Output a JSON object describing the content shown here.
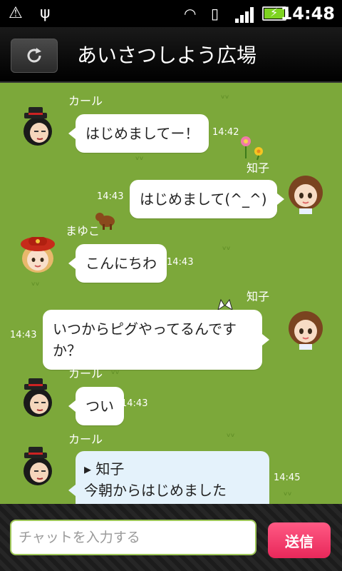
{
  "status_bar": {
    "time": "14:48",
    "icons": [
      "warning-icon",
      "usb-icon",
      "wifi-icon",
      "rotate-icon",
      "signal-icon",
      "battery-charging-icon"
    ]
  },
  "header": {
    "title": "あいさつしよう広場",
    "refresh_icon": "refresh-icon"
  },
  "messages": [
    {
      "sender": "カール",
      "text": "はじめましてー！",
      "time": "14:42",
      "side": "left"
    },
    {
      "sender": "知子",
      "text": "はじめまして(^_^)",
      "time": "14:43",
      "side": "right"
    },
    {
      "sender": "まゆこ",
      "text": "こんにちわ",
      "time": "14:43",
      "side": "left"
    },
    {
      "sender": "知子",
      "text": "いつからピグやってるんですか？",
      "time": "14:43",
      "side": "right"
    },
    {
      "sender": "カール",
      "text": "つい",
      "time": "14:43",
      "side": "left"
    },
    {
      "sender": "カール",
      "reply_to": "▸ 知子",
      "text": "今朝からはじめました(^^)v",
      "time": "14:45",
      "side": "left"
    }
  ],
  "input": {
    "placeholder": "チャットを入力する",
    "value": ""
  },
  "send_button": {
    "label": "送信"
  },
  "colors": {
    "grass_bg": "#7ca83a",
    "send_button": "#f0396a",
    "reply_bubble": "#e4f2fb"
  }
}
